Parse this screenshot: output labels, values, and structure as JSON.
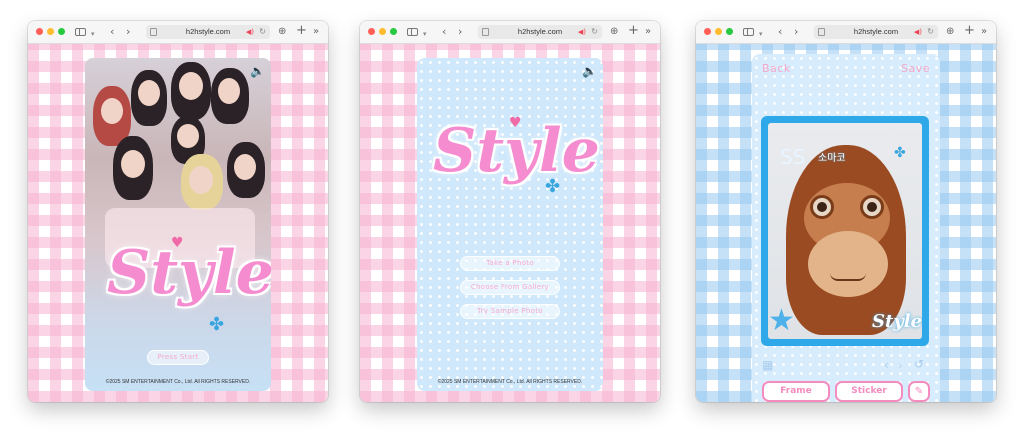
{
  "browser": {
    "url": "h2hstyle.com",
    "icons": {
      "sidebar": "sidebar-icon",
      "back": "‹",
      "forward": "›",
      "download": "⊕",
      "new_tab": "+",
      "more": "»"
    }
  },
  "screens": [
    {
      "id": "splash",
      "logo_text": "Style",
      "press_start": "Press Start",
      "copyright": "©2025 SM ENTERTAINMENT Co., Ltd. All RIGHTS RESERVED."
    },
    {
      "id": "menu",
      "logo_text": "Style",
      "buttons": [
        "Take a Photo",
        "Choose From Gallery",
        "Try Sample Photo"
      ],
      "copyright": "©2025 SM ENTERTAINMENT Co., Ltd. All RIGHTS RESERVED."
    },
    {
      "id": "editor",
      "back": "Back",
      "save": "Save",
      "frame_text": "소마코",
      "frame_logo": "Style",
      "frame_button": "Frame",
      "sticker_button": "Sticker"
    }
  ],
  "colors": {
    "pink_accent": "#f48cc0",
    "blue_frame": "#2ea8e8",
    "card_blue": "#cfe8fb"
  }
}
